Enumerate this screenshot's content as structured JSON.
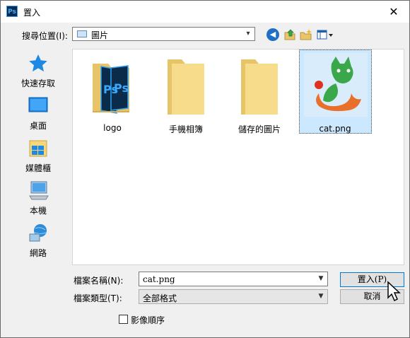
{
  "window": {
    "title": "置入",
    "app_icon": "Ps"
  },
  "toolbar": {
    "lookin_label": "搜尋位置(I):",
    "location": "圖片"
  },
  "places": [
    {
      "label": "快速存取",
      "icon": "star-icon"
    },
    {
      "label": "桌面",
      "icon": "desktop-icon"
    },
    {
      "label": "媒體櫃",
      "icon": "library-icon"
    },
    {
      "label": "本機",
      "icon": "computer-icon"
    },
    {
      "label": "網路",
      "icon": "network-icon"
    }
  ],
  "files": [
    {
      "name": "logo",
      "kind": "folder"
    },
    {
      "name": "手機相簿",
      "kind": "folder"
    },
    {
      "name": "儲存的圖片",
      "kind": "folder"
    },
    {
      "name": "cat.png",
      "kind": "image",
      "selected": true
    }
  ],
  "bottom": {
    "filename_label": "檔案名稱(N):",
    "filename_value": "cat.png",
    "filetype_label": "檔案類型(T):",
    "filetype_value": "全部格式",
    "ok_label": "置入(P)",
    "cancel_label": "取消",
    "sequence_label": "影像順序"
  },
  "colors": {
    "accent": "#0078d7",
    "selection": "#cce8ff",
    "folder": "#f5d67b",
    "cat_green": "#3aa84a",
    "cat_orange": "#e8702a"
  }
}
